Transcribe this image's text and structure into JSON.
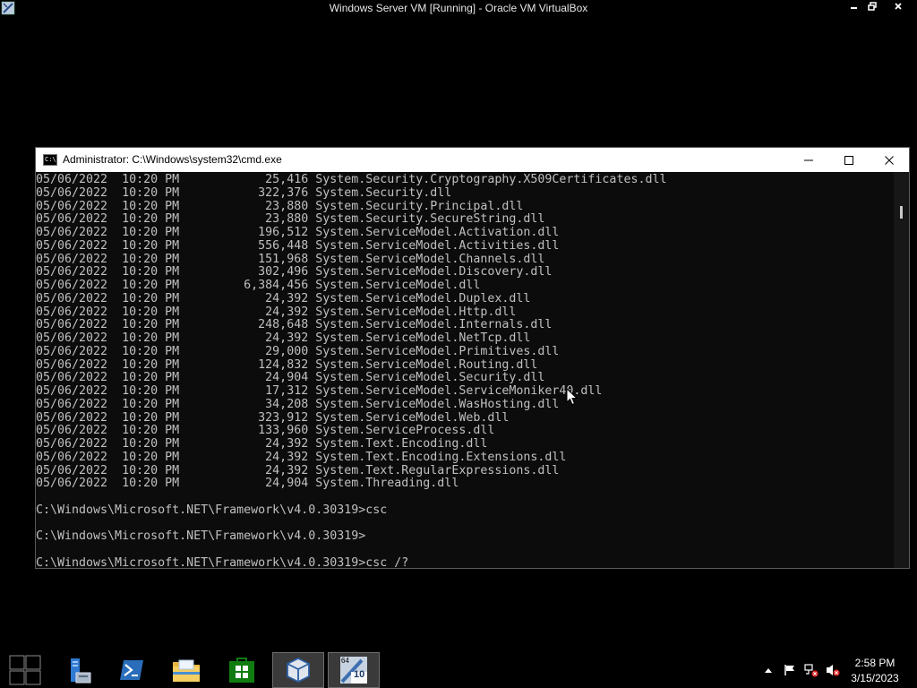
{
  "host": {
    "title": "Windows Server VM [Running] - Oracle VM VirtualBox",
    "icons": [
      "virtualbox-app-icon",
      "minimize-icon",
      "restore-icon",
      "close-icon"
    ]
  },
  "cmd": {
    "title": "Administrator: C:\\Windows\\system32\\cmd.exe",
    "icon_label": "C:\\",
    "lines": [
      "05/06/2022  10:20 PM            25,416 System.Security.Cryptography.X509Certificates.dll",
      "05/06/2022  10:20 PM           322,376 System.Security.dll",
      "05/06/2022  10:20 PM            23,880 System.Security.Principal.dll",
      "05/06/2022  10:20 PM            23,880 System.Security.SecureString.dll",
      "05/06/2022  10:20 PM           196,512 System.ServiceModel.Activation.dll",
      "05/06/2022  10:20 PM           556,448 System.ServiceModel.Activities.dll",
      "05/06/2022  10:20 PM           151,968 System.ServiceModel.Channels.dll",
      "05/06/2022  10:20 PM           302,496 System.ServiceModel.Discovery.dll",
      "05/06/2022  10:20 PM         6,384,456 System.ServiceModel.dll",
      "05/06/2022  10:20 PM            24,392 System.ServiceModel.Duplex.dll",
      "05/06/2022  10:20 PM            24,392 System.ServiceModel.Http.dll",
      "05/06/2022  10:20 PM           248,648 System.ServiceModel.Internals.dll",
      "05/06/2022  10:20 PM            24,392 System.ServiceModel.NetTcp.dll",
      "05/06/2022  10:20 PM            29,000 System.ServiceModel.Primitives.dll",
      "05/06/2022  10:20 PM           124,832 System.ServiceModel.Routing.dll",
      "05/06/2022  10:20 PM            24,904 System.ServiceModel.Security.dll",
      "05/06/2022  10:20 PM            17,312 System.ServiceModel.ServiceMoniker40.dll",
      "05/06/2022  10:20 PM            34,208 System.ServiceModel.WasHosting.dll",
      "05/06/2022  10:20 PM           323,912 System.ServiceModel.Web.dll",
      "05/06/2022  10:20 PM           133,960 System.ServiceProcess.dll",
      "05/06/2022  10:20 PM            24,392 System.Text.Encoding.dll",
      "05/06/2022  10:20 PM            24,392 System.Text.Encoding.Extensions.dll",
      "05/06/2022  10:20 PM            24,392 System.Text.RegularExpressions.dll",
      "05/06/2022  10:20 PM            24,904 System.Threading.dll",
      "",
      "C:\\Windows\\Microsoft.NET\\Framework\\v4.0.30319>csc",
      "",
      "C:\\Windows\\Microsoft.NET\\Framework\\v4.0.30319>",
      "",
      "C:\\Windows\\Microsoft.NET\\Framework\\v4.0.30319>csc /?"
    ]
  },
  "taskbar": {
    "apps": [
      {
        "name": "start-button",
        "icon": "windows-start-icon",
        "active": false
      },
      {
        "name": "server-manager-button",
        "icon": "server-manager-icon",
        "active": false
      },
      {
        "name": "powershell-button",
        "icon": "powershell-icon",
        "active": false
      },
      {
        "name": "file-explorer-button",
        "icon": "folder-icon",
        "active": false
      },
      {
        "name": "store-button",
        "icon": "store-icon",
        "active": false
      },
      {
        "name": "virtualbox-button",
        "icon": "virtualbox-cube-icon",
        "active": true
      },
      {
        "name": "virtualbox-vm-button",
        "icon": "virtualbox-vm-icon",
        "active": true
      }
    ],
    "vm_badge_top": "64",
    "vm_badge_bottom": "10",
    "tray_icons": [
      "show-hidden-icons-chevron",
      "action-center-flag-icon",
      "network-error-icon",
      "volume-muted-icon"
    ],
    "clock": {
      "time": "2:58 PM",
      "date": "3/15/2023"
    }
  },
  "colors": {
    "cmd_bg": "#0c0c0c",
    "cmd_text": "#c0c0c0",
    "store_green": "#107c10",
    "powershell_blue": "#2a6ebb"
  }
}
